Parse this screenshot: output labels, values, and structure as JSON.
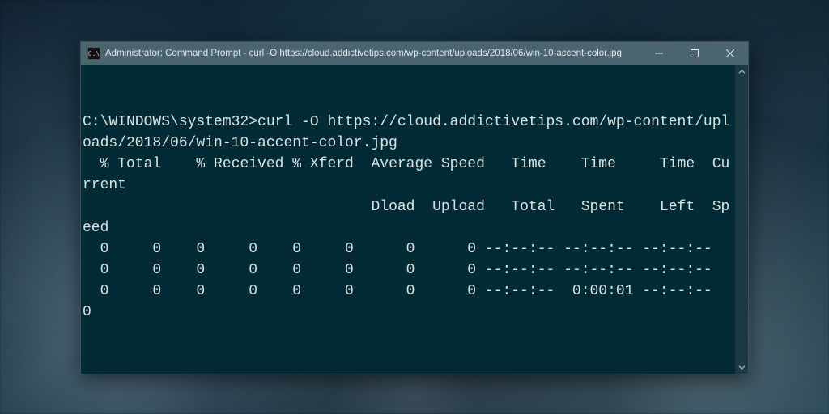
{
  "titlebar": {
    "icon_text": "C:\\",
    "title": "Administrator: Command Prompt - curl  -O https://cloud.addictivetips.com/wp-content/uploads/2018/06/win-10-accent-color.jpg"
  },
  "terminal": {
    "prompt": "C:\\WINDOWS\\system32>",
    "command": "curl -O https://cloud.addictivetips.com/wp-content/uploads/2018/06/win-10-accent-color.jpg",
    "header": "  % Total    % Received % Xferd  Average Speed   Time    Time     Time  Current",
    "subheader": "                                 Dload  Upload   Total   Spent    Left  Speed",
    "rows": [
      "  0     0    0     0    0     0      0      0 --:--:-- --:--:-- --:--:--",
      "  0     0    0     0    0     0      0      0 --:--:-- --:--:-- --:--:--",
      "  0     0    0     0    0     0      0      0 --:--:--  0:00:01 --:--:--     0"
    ]
  },
  "colors": {
    "terminal_bg": "#022b36",
    "terminal_fg": "#d7e3e3",
    "titlebar_bg": "#4a6470"
  }
}
